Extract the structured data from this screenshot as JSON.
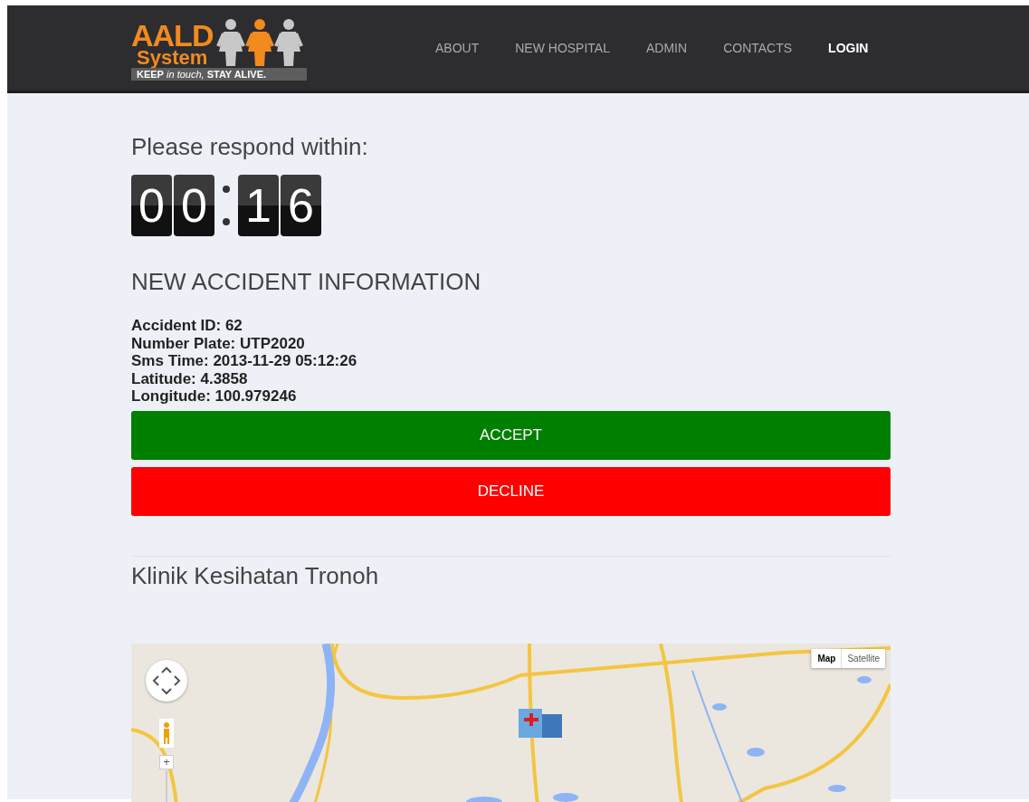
{
  "logo": {
    "title": "AALD",
    "subtitle": "System",
    "tagline_start": "KEEP",
    "tagline_middle": "in touch,",
    "tagline_end": "STAY ALIVE."
  },
  "nav": [
    {
      "label": "ABOUT",
      "selected": false
    },
    {
      "label": "NEW HOSPITAL",
      "selected": false
    },
    {
      "label": "ADMIN",
      "selected": false
    },
    {
      "label": "CONTACTS",
      "selected": false
    },
    {
      "label": "LOGIN",
      "selected": true
    }
  ],
  "countdown": {
    "label": "Please respond within:",
    "groups": [
      [
        "0",
        "0"
      ],
      [
        "1",
        "6"
      ]
    ]
  },
  "section_title": "NEW ACCIDENT INFORMATION",
  "info": [
    "Accident ID: 62",
    "Number Plate: UTP2020",
    "Sms Time: 2013-11-29 05:12:26",
    "Latitude: 4.3858",
    "Longitude: 100.979246"
  ],
  "actions": [
    {
      "label": "ACCEPT",
      "kind": "accept"
    },
    {
      "label": "DECLINE",
      "kind": "decline"
    }
  ],
  "hospital": "Klinik Kesihatan Tronoh",
  "map": {
    "kind": "picture",
    "zoom_in": "+",
    "types": [
      {
        "label": "Map",
        "selected": true
      },
      {
        "label": "Satellite",
        "selected": false
      }
    ]
  }
}
